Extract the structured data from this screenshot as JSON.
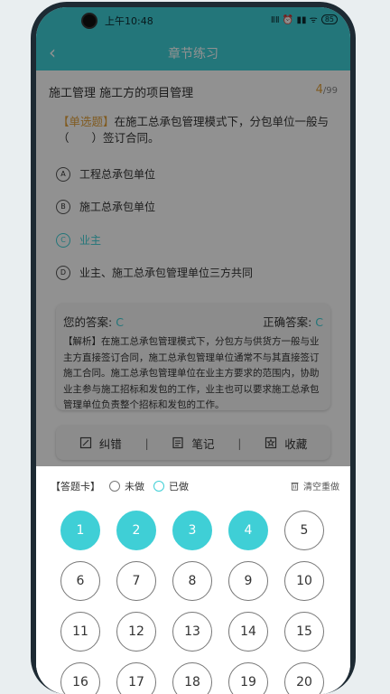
{
  "status_bar": {
    "time": "上午10:48",
    "battery": "85",
    "icons_text": "ⅡⅡ ⏰ ▮▮ ᯤ"
  },
  "header": {
    "title": "章节练习"
  },
  "chapter": {
    "name": "施工管理  施工方的项目管理",
    "current": "4",
    "total": "/99"
  },
  "question": {
    "type": "【单选题】",
    "text": "在施工总承包管理模式下，分包单位一般与（　　）签订合同。",
    "options": [
      {
        "letter": "A",
        "text": "工程总承包单位"
      },
      {
        "letter": "B",
        "text": "施工总承包单位"
      },
      {
        "letter": "C",
        "text": "业主"
      },
      {
        "letter": "D",
        "text": "业主、施工总承包管理单位三方共同"
      }
    ]
  },
  "answer": {
    "yours_label": "您的答案:",
    "yours_value": "C",
    "correct_label": "正确答案:",
    "correct_value": "C",
    "analysis": "【解析】在施工总承包管理模式下，分包方与供货方一般与业主方直接签订合同，施工总承包管理单位通常不与其直接签订施工合同。施工总承包管理单位在业主方要求的范围内，协助业主参与施工招标和发包的工作，业主也可以要求施工总承包管理单位负责整个招标和发包的工作。"
  },
  "tools": {
    "correct_error": "纠错",
    "notes": "笔记",
    "favorite": "收藏",
    "separator": "|"
  },
  "answer_card": {
    "title": "【答题卡】",
    "legend_undone": "未做",
    "legend_done": "已做",
    "clear": "清空重做",
    "numbers": [
      {
        "n": "1",
        "done": true
      },
      {
        "n": "2",
        "done": true
      },
      {
        "n": "3",
        "done": true
      },
      {
        "n": "4",
        "done": true
      },
      {
        "n": "5",
        "done": false
      },
      {
        "n": "6",
        "done": false
      },
      {
        "n": "7",
        "done": false
      },
      {
        "n": "8",
        "done": false
      },
      {
        "n": "9",
        "done": false
      },
      {
        "n": "10",
        "done": false
      },
      {
        "n": "11",
        "done": false
      },
      {
        "n": "12",
        "done": false
      },
      {
        "n": "13",
        "done": false
      },
      {
        "n": "14",
        "done": false
      },
      {
        "n": "15",
        "done": false
      },
      {
        "n": "16",
        "done": false
      },
      {
        "n": "17",
        "done": false
      },
      {
        "n": "18",
        "done": false
      },
      {
        "n": "19",
        "done": false
      },
      {
        "n": "20",
        "done": false
      }
    ]
  },
  "colors": {
    "accent": "#3fcfd6",
    "orange": "#e2a13a"
  }
}
